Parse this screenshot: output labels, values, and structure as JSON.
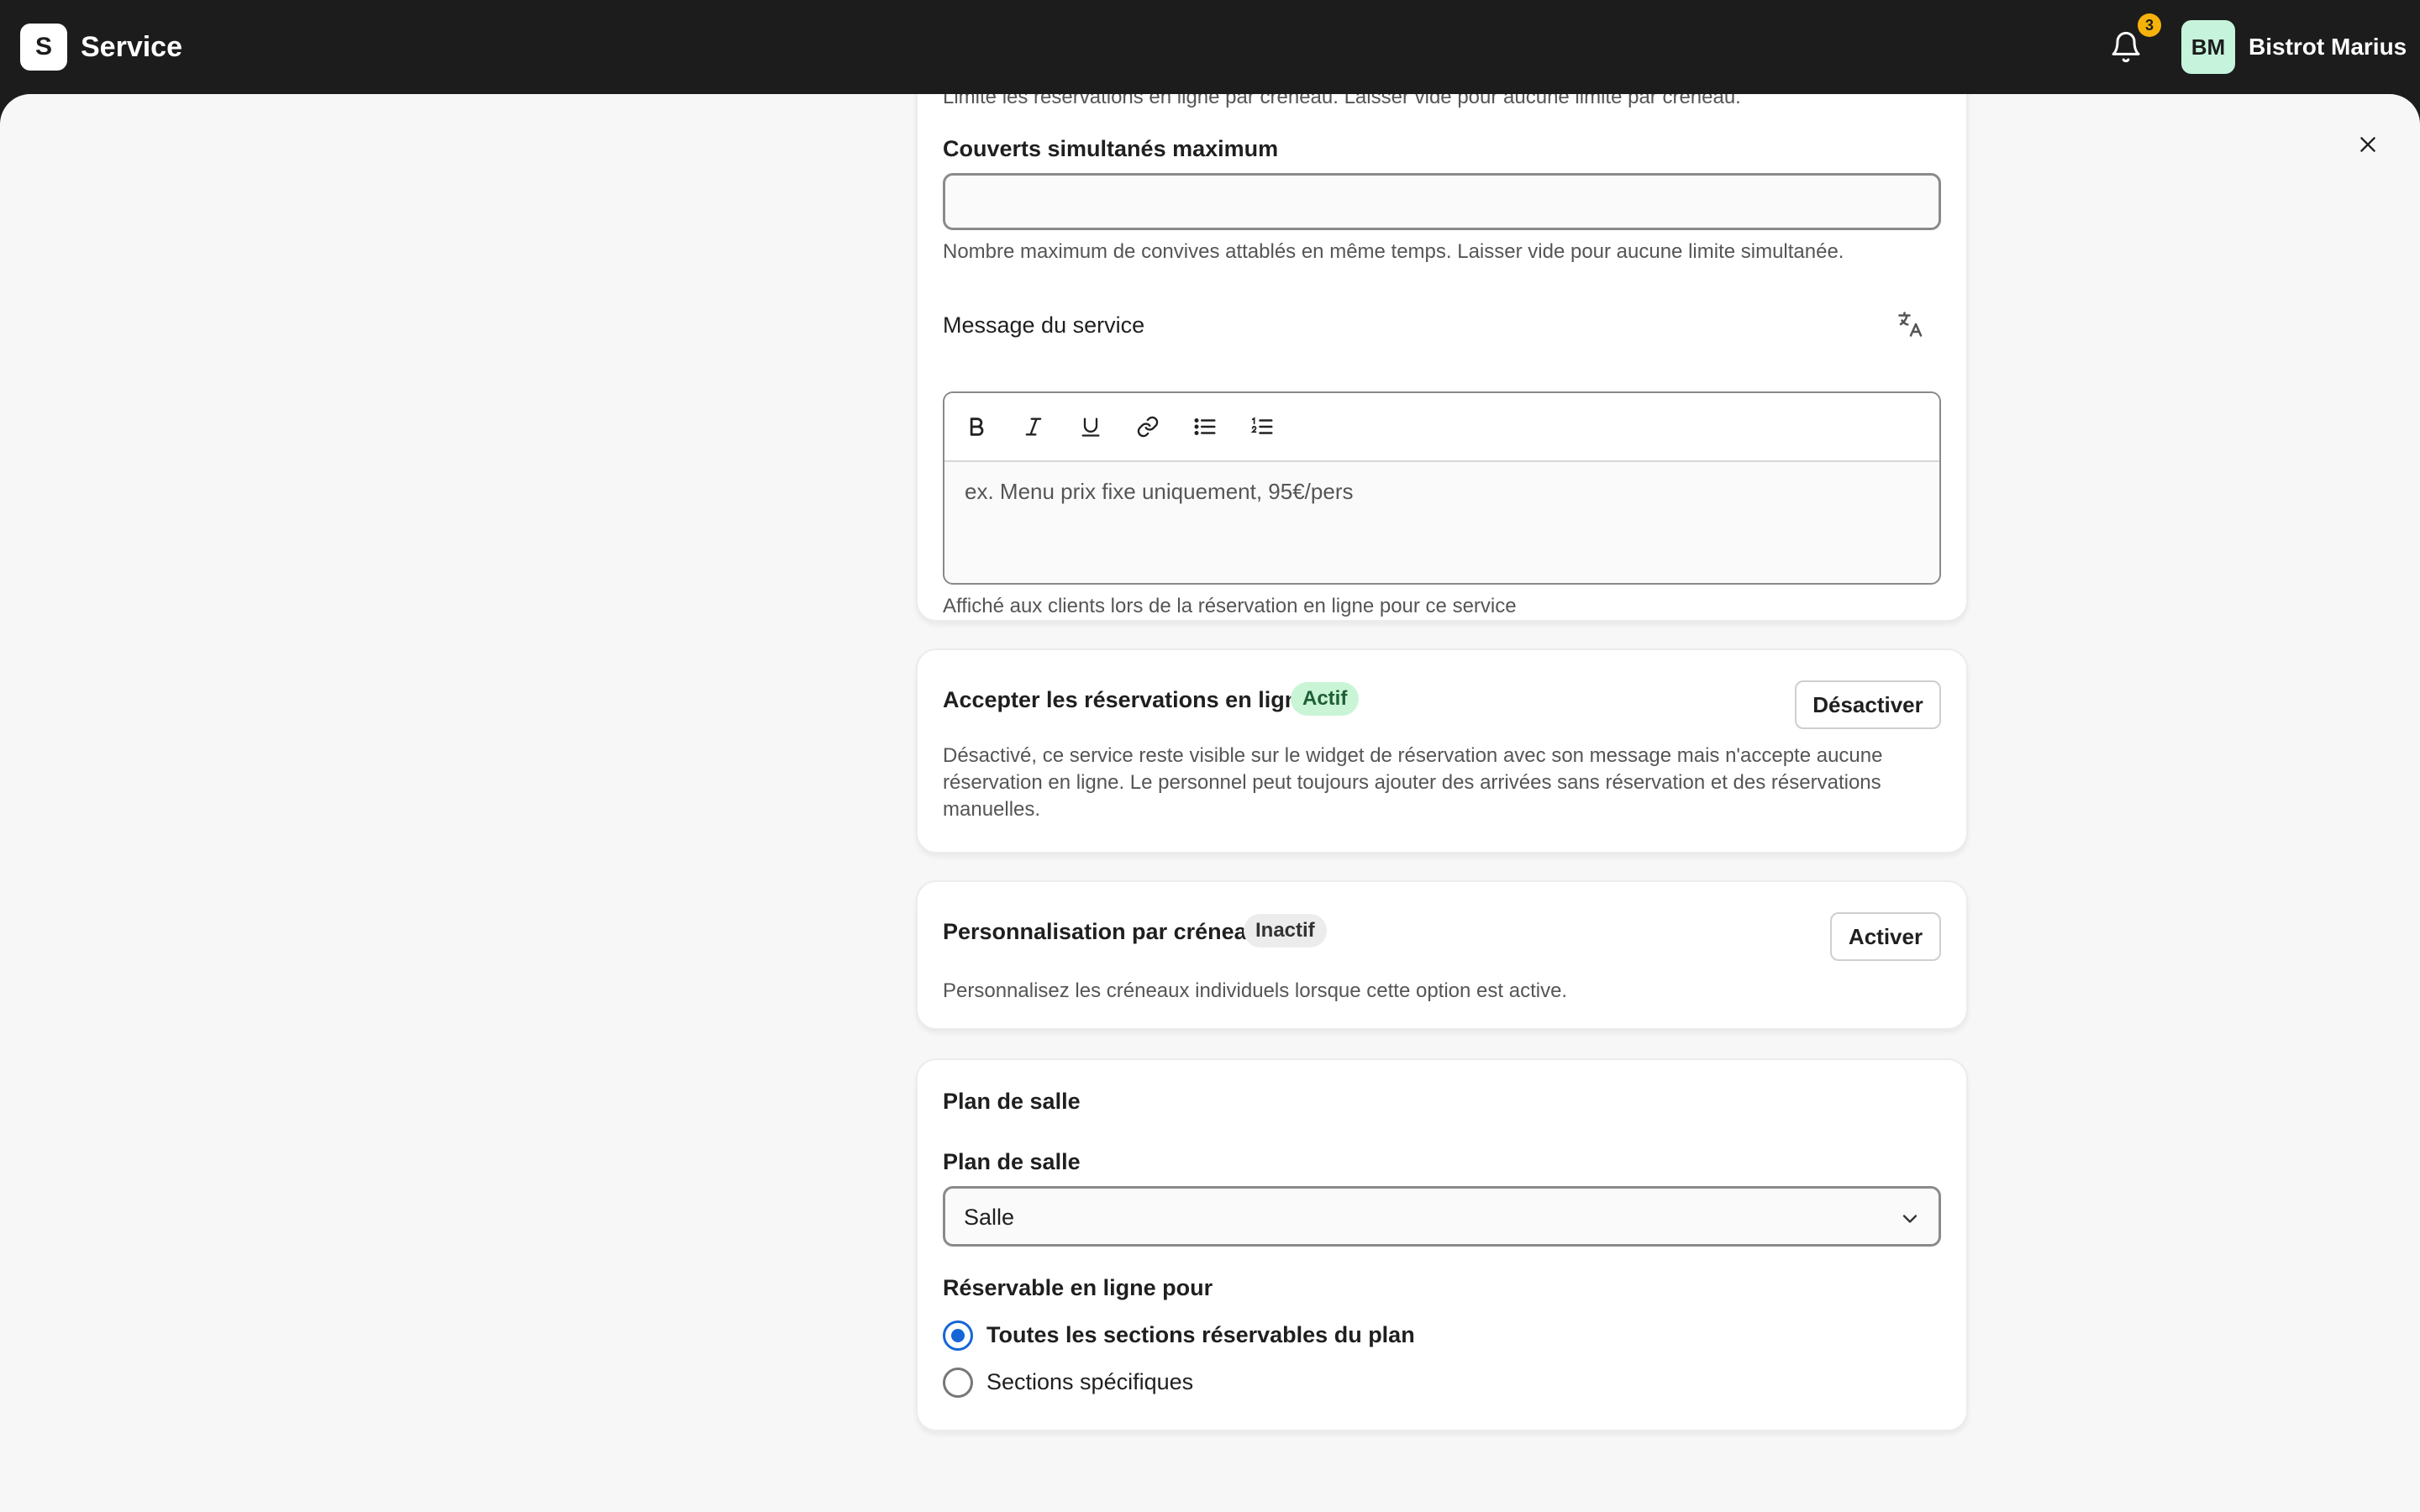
{
  "app": {
    "logo_letter": "S",
    "title": "Service"
  },
  "header": {
    "notification_count": "3",
    "avatar_initials": "BM",
    "user_name": "Bistrot Marius"
  },
  "colors": {
    "topbar": "#1c1c1c",
    "active_badge_bg": "#c9f5d6",
    "notif_badge": "#f5b20b",
    "radio_selected": "#1565d8"
  },
  "card1": {
    "clipped_hint": "Limite les réservations en ligne par créneau. Laisser vide pour aucune limite par créneau.",
    "max_covers_label": "Couverts simultanés maximum",
    "max_covers_value": "",
    "max_covers_hint": "Nombre maximum de convives attablés en même temps. Laisser vide pour aucune limite simultanée.",
    "message_label": "Message du service",
    "message_placeholder": "ex. Menu prix fixe uniquement, 95€/pers",
    "message_hint": "Affiché aux clients lors de la réservation en ligne pour ce service",
    "toolbar_icons": [
      "bold-icon",
      "italic-icon",
      "underline-icon",
      "link-icon",
      "bullet-list-icon",
      "numbered-list-icon"
    ]
  },
  "card2": {
    "title": "Accepter les réservations en ligne",
    "status": "Actif",
    "button": "Désactiver",
    "description_line1": "Désactivé, ce service reste visible sur le widget de réservation avec son message mais n'accepte aucune",
    "description_line2": "réservation en ligne. Le personnel peut toujours ajouter des arrivées sans réservation et des réservations",
    "description_line3": "manuelles."
  },
  "card3": {
    "title": "Personnalisation par créneau",
    "status": "Inactif",
    "button": "Activer",
    "description": "Personnalisez les créneaux individuels lorsque cette option est active."
  },
  "card4": {
    "section_title": "Plan de salle",
    "field_label": "Plan de salle",
    "select_value": "Salle",
    "online_label": "Réservable en ligne pour",
    "options": [
      {
        "label": "Toutes les sections réservables du plan",
        "selected": true
      },
      {
        "label": "Sections spécifiques",
        "selected": false
      }
    ]
  }
}
